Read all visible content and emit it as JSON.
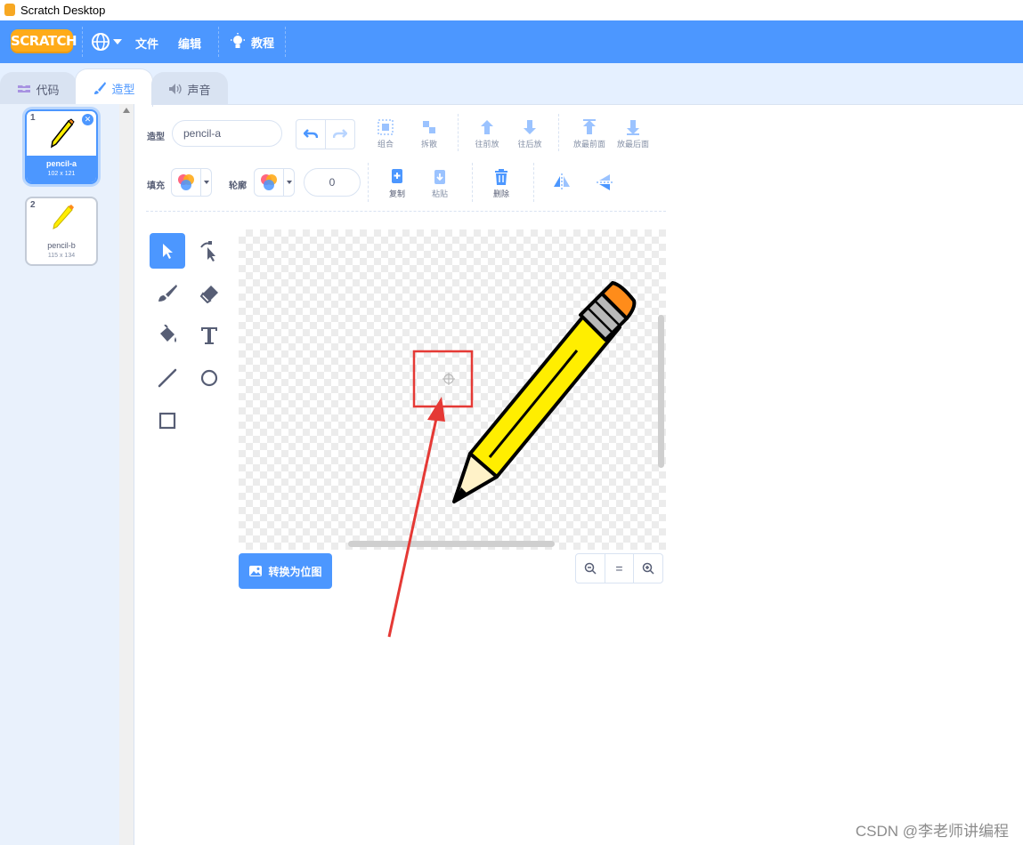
{
  "window": {
    "title": "Scratch Desktop"
  },
  "menubar": {
    "logo": "SCRATCH",
    "file": "文件",
    "edit": "编辑",
    "tutorials": "教程",
    "color": "#4c97ff"
  },
  "tabs": [
    {
      "label": "代码",
      "icon": "code-icon"
    },
    {
      "label": "造型",
      "icon": "brush-icon",
      "active": true
    },
    {
      "label": "声音",
      "icon": "speaker-icon"
    }
  ],
  "costumes": [
    {
      "index": "1",
      "name": "pencil-a",
      "size": "102 x 121",
      "selected": true
    },
    {
      "index": "2",
      "name": "pencil-b",
      "size": "115 x 134",
      "selected": false
    }
  ],
  "toolbar": {
    "costume_label": "造型",
    "costume_name": "pencil-a",
    "group": "组合",
    "ungroup": "拆散",
    "forward": "往前放",
    "backward": "往后放",
    "front": "放最前面",
    "back": "放最后面",
    "fill_label": "填充",
    "outline_label": "轮廓",
    "outline_width": "0",
    "copy": "复制",
    "paste": "粘贴",
    "delete": "删除"
  },
  "tools": [
    "select-tool",
    "reshape-tool",
    "brush-tool",
    "eraser-tool",
    "fill-tool",
    "text-tool",
    "line-tool",
    "circle-tool",
    "rect-tool"
  ],
  "canvas": {
    "convert_button": "转换为位图",
    "zoom_out": "zoom-out-icon",
    "zoom_reset": "=",
    "zoom_in": "zoom-in-icon"
  },
  "annotation": {
    "color": "#e53935"
  },
  "watermark": "CSDN @李老师讲编程"
}
